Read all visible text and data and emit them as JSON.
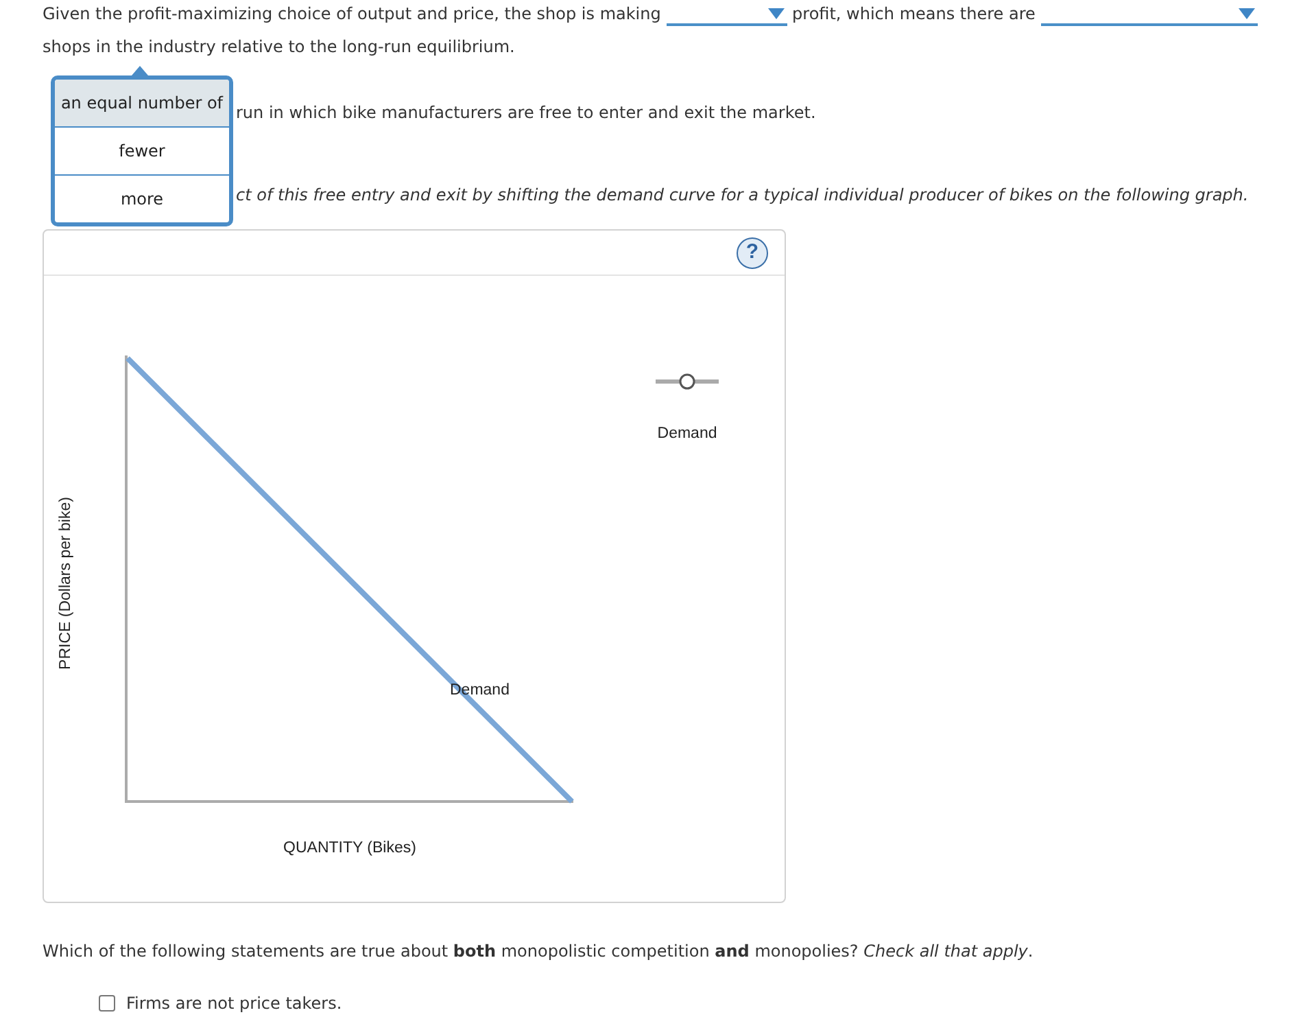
{
  "question_1": {
    "segments": [
      {
        "kind": "text",
        "text": "Given the profit-maximizing choice of output and price, the shop is making"
      },
      {
        "kind": "dropdown"
      },
      {
        "kind": "text",
        "text": "profit, which means there are"
      },
      {
        "kind": "dropdown"
      },
      {
        "kind": "text",
        "text": "shops in the industry relative to the long-run equilibrium."
      }
    ]
  },
  "dropdown_menu": {
    "options": [
      {
        "label": "an equal number of",
        "selected": true
      },
      {
        "label": "fewer",
        "selected": false
      },
      {
        "label": "more",
        "selected": false
      }
    ]
  },
  "paragraph": "run in which bike manufacturers are free to enter and exit the market.",
  "instruction": "ct of this free entry and exit by shifting the demand curve for a typical individual producer of bikes on the following graph.",
  "graph": {
    "help_button": "?",
    "y_axis_label": "PRICE (Dollars per bike)",
    "x_axis_label": "QUANTITY (Bikes)",
    "curve_label": "Demand",
    "legend": [
      {
        "label": "Demand"
      }
    ]
  },
  "question_2": {
    "prompt": "Which of the following statements are true about **both** monopolistic competition **and** monopolies? *Check all that apply*.",
    "options": [
      {
        "label": "Firms are not price takers.",
        "checked": false
      }
    ]
  }
}
